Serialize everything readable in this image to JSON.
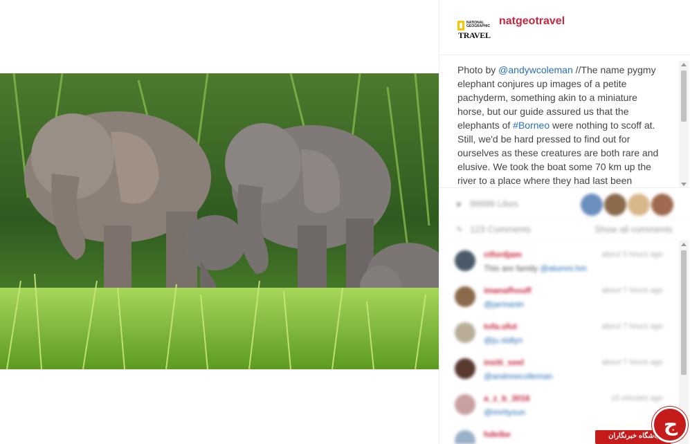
{
  "post": {
    "username": "natgeotravel",
    "logo": {
      "top_text": "NATIONAL GEOGRAPHIC",
      "main_text": "TRAVEL",
      "frame_color": "#f7c600"
    },
    "caption": {
      "prefix": "Photo by ",
      "mention": "@andywcoleman",
      "part1": " //The name pygmy elephant conjures up images of a petite pachyderm, something akin to a miniature horse, but our guide assured us that the elephants of ",
      "hashtag": "#Borneo",
      "part2": " were nothing to scoff at. Still, we'd be hard pressed to find out for ourselves as these creatures are both rare and elusive. We took the boat some 70 km up the river to a place where they had last been"
    },
    "likes_text": "99999 Likes",
    "comments_count_text": "123 Comments",
    "show_all_text": "Show all comments"
  },
  "comments": [
    {
      "name": "ctfordjam",
      "text_prefix": "This are family ",
      "mention": "@alumni.hm",
      "time": "about 5 hours ago",
      "avatar_color": "#4a5a6a"
    },
    {
      "name": "imanafhouff",
      "text_prefix": "",
      "mention": "@jarmanin",
      "time": "about 7 hours ago",
      "avatar_color": "#8a6a4a"
    },
    {
      "name": "tofa.ufut",
      "text_prefix": "",
      "mention": "@ju.stdlyn",
      "time": "about 7 hours ago",
      "avatar_color": "#b8ad98"
    },
    {
      "name": "insiti_seel",
      "text_prefix": "",
      "mention": "@andrewcolleman",
      "time": "about 7 hours ago",
      "avatar_color": "#5a3a30"
    },
    {
      "name": "a_z_b_3016",
      "text_prefix": "",
      "mention": "@imritysun",
      "time": "15 minutes ago",
      "avatar_color": "#c9a0a0"
    },
    {
      "name": "hdeibe",
      "text_prefix": "",
      "mention": "",
      "time": "",
      "avatar_color": "#9ab0c8"
    }
  ],
  "watermark": {
    "text": "باشگاه خبرنگاران",
    "glyph": "ج",
    "color": "#c61b1b"
  },
  "colors": {
    "username": "#c6283f",
    "link": "#2a6fb5",
    "text": "#444444"
  }
}
